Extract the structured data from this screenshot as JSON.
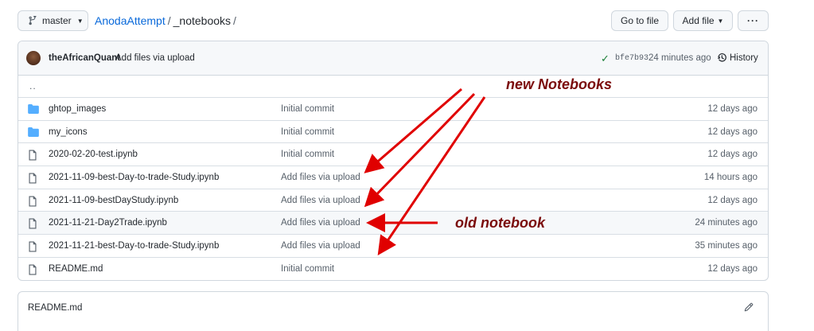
{
  "topbar": {
    "branch": "master",
    "repo": "AnodaAttempt",
    "sep1": "/",
    "folder": "_notebooks",
    "sep2": "/",
    "goto_label": "Go to file",
    "addfile_label": "Add file",
    "more_label": "···"
  },
  "commit": {
    "author": "theAfricanQuant",
    "message": "Add files via upload",
    "sha": "bfe7b93",
    "ago": "24 minutes ago",
    "history_label": "History"
  },
  "parent_dir": "..",
  "files": [
    {
      "name": "ghtop_images",
      "message": "Initial commit",
      "time": "12 days ago",
      "type": "folder"
    },
    {
      "name": "my_icons",
      "message": "Initial commit",
      "time": "12 days ago",
      "type": "folder"
    },
    {
      "name": "2020-02-20-test.ipynb",
      "message": "Initial commit",
      "time": "12 days ago",
      "type": "file"
    },
    {
      "name": "2021-11-09-best-Day-to-trade-Study.ipynb",
      "message": "Add files via upload",
      "time": "14 hours ago",
      "type": "file"
    },
    {
      "name": "2021-11-09-bestDayStudy.ipynb",
      "message": "Add files via upload",
      "time": "12 days ago",
      "type": "file"
    },
    {
      "name": "2021-11-21-Day2Trade.ipynb",
      "message": "Add files via upload",
      "time": "24 minutes ago",
      "type": "file"
    },
    {
      "name": "2021-11-21-best-Day-to-trade-Study.ipynb",
      "message": "Add files via upload",
      "time": "35 minutes ago",
      "type": "file"
    },
    {
      "name": "README.md",
      "message": "Initial commit",
      "time": "12 days ago",
      "type": "file"
    }
  ],
  "readme": {
    "title": "README.md"
  },
  "annotations": {
    "new_label": "new Notebooks",
    "old_label": "old notebook",
    "color": "#e00000"
  },
  "colors": {
    "link": "#0969da",
    "folder_icon": "#54aeff",
    "check": "#1a7f37"
  }
}
